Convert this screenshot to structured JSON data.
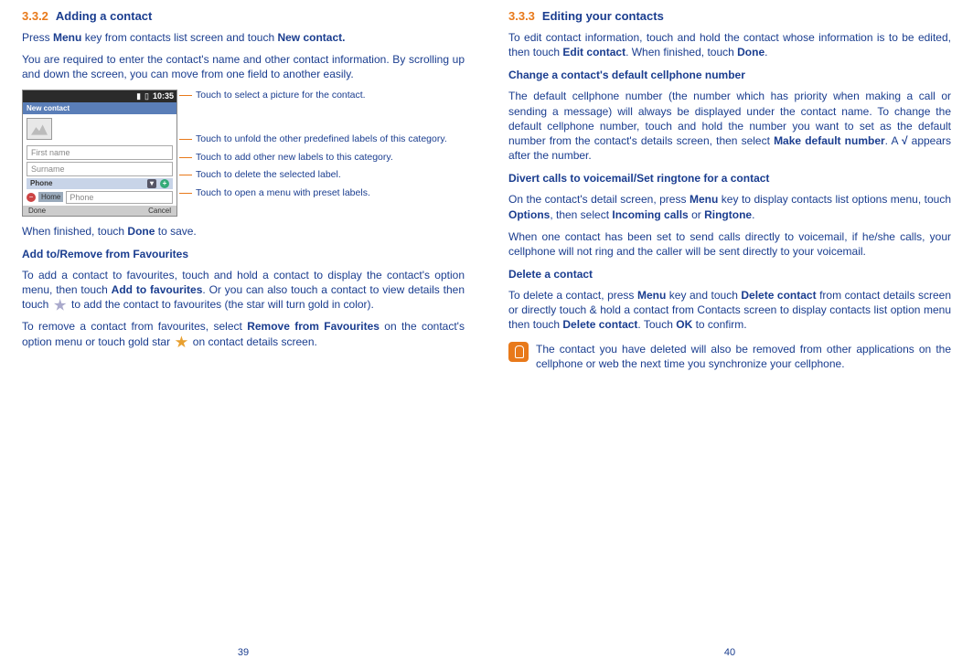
{
  "left": {
    "section_num": "3.3.2",
    "section_title": "Adding a contact",
    "p1a": "Press ",
    "p1b": "Menu",
    "p1c": " key from contacts list screen and touch ",
    "p1d": "New contact.",
    "p2": "You are required to enter the contact's name and other contact information. By scrolling up and down the screen, you can move from one field to another easily.",
    "shot": {
      "time": "10:35",
      "title": "New contact",
      "first": "First name",
      "surname": "Surname",
      "phone_label": "Phone",
      "home": "Home",
      "phone_placeholder": "Phone",
      "done": "Done",
      "cancel": "Cancel"
    },
    "annot1": "Touch to select a picture for the contact.",
    "annot2": "Touch to unfold the other predefined labels of this category.",
    "annot3": "Touch to add other new labels to this category.",
    "annot4": "Touch to delete the selected label.",
    "annot5": "Touch to open a menu with preset labels.",
    "p3a": "When finished, touch ",
    "p3b": "Done",
    "p3c": " to save.",
    "h3_1": "Add to/Remove from Favourites",
    "p4a": "To add a contact to favourites, touch and hold a contact to display the contact's option menu, then touch ",
    "p4b": "Add to favourites",
    "p4c": ". Or you can also touch a contact to view details then touch ",
    "p4d": " to add the contact to favourites (the star will turn gold in color).",
    "p5a": "To remove a contact from favourites, select ",
    "p5b": "Remove from Favourites",
    "p5c": " on the contact's option menu or touch gold star ",
    "p5d": " on contact details screen.",
    "pagenum": "39"
  },
  "right": {
    "section_num": "3.3.3",
    "section_title": "Editing your contacts",
    "p1a": "To edit contact information, touch and hold the contact whose information is to be edited, then touch ",
    "p1b": "Edit contact",
    "p1c": ". When finished, touch ",
    "p1d": "Done",
    "p1e": ".",
    "h3_1": "Change a contact's default cellphone number",
    "p2a": "The default cellphone number (the number which has priority when making a call or sending a message) will always be displayed under the contact name. To change the default cellphone number, touch and hold the number you want to set as the default number from the contact's details screen, then select ",
    "p2b": "Make default number",
    "p2c": ". A ",
    "p2check": "√",
    "p2d": " appears after the number.",
    "h3_2": "Divert calls to voicemail/Set ringtone for a contact",
    "p3a": "On the contact's detail screen, press ",
    "p3b": "Menu",
    "p3c": " key to display contacts list options menu, touch ",
    "p3d": "Options",
    "p3e": ", then select ",
    "p3f": "Incoming calls",
    "p3g": " or ",
    "p3h": "Ringtone",
    "p3i": ".",
    "p4": "When one contact has been set to send calls directly to voicemail, if he/she calls, your cellphone will not ring and the caller will be sent directly to your voicemail.",
    "h3_3": "Delete a contact",
    "p5a": "To delete a contact, press ",
    "p5b": "Menu",
    "p5c": " key and touch ",
    "p5d": "Delete contact",
    "p5e": " from contact details screen or directly touch & hold a contact from Contacts screen to display contacts list option menu then touch ",
    "p5f": "Delete contact",
    "p5g": ". Touch ",
    "p5h": "OK",
    "p5i": " to confirm.",
    "tip": "The contact you have deleted will also be removed from other applications on the cellphone or web the next time you synchronize your cellphone.",
    "pagenum": "40"
  }
}
